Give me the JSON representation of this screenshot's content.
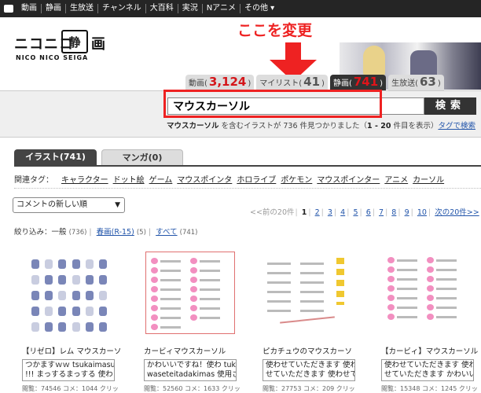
{
  "topbar": {
    "items": [
      "動画",
      "静画",
      "生放送",
      "チャンネル",
      "大百科",
      "実況",
      "Nアニメ",
      "その他 ▾"
    ]
  },
  "logo": {
    "line1a": "ニコニコ",
    "line1box": "静",
    "line1b": "画",
    "line2": "NICO NICO SEIGA"
  },
  "annotation": {
    "text": "ここを変更",
    "color": "#ee2222"
  },
  "service_tabs": [
    {
      "label": "動画(",
      "count": "3,124",
      "close": ")"
    },
    {
      "label": "マイリスト(",
      "count": "41",
      "close": ")"
    },
    {
      "label": "静画(",
      "count": "741",
      "close": ")"
    },
    {
      "label": "生放送(",
      "count": "63",
      "close": ")"
    }
  ],
  "search": {
    "query": "マウスカーソル",
    "button": "検索"
  },
  "result": {
    "keyword": "マウスカーソル",
    "text1": " を含むイラストが ",
    "count": "736",
    "text2": " 件見つかりました（",
    "range": "1 - 20",
    "text3": " 件目を表示）",
    "link": "タグで検索"
  },
  "content_tabs": [
    "イラスト(741)",
    "マンガ(0)"
  ],
  "related_tags": {
    "label": "関連タグ：",
    "tags": [
      "キャラクター",
      "ドット絵",
      "ゲーム",
      "マウスポインタ",
      "ホロライブ",
      "ポケモン",
      "マウスポインター",
      "アニメ",
      "カーソル"
    ]
  },
  "sort": {
    "selected": "コメントの新しい順",
    "chevron": "▼"
  },
  "pager": {
    "prev": "<<前の20件",
    "pages": [
      "1",
      "2",
      "3",
      "4",
      "5",
      "6",
      "7",
      "8",
      "9",
      "10"
    ],
    "next": "次の20件>>"
  },
  "filter": {
    "label": "絞り込み：",
    "general": "一般",
    "general_count": "(736)",
    "spring": "春画(R-15)",
    "spring_count": "(5)",
    "all": "すべて",
    "all_count": "(741)"
  },
  "cards": [
    {
      "title": "【リゼロ】レム マウスカーソ",
      "desc1": "つかますｗｗ tsukaimasu",
      "desc2": "!!! まっするまっする 使わ",
      "stats": "閲覧：74546 コメ：1044 クリッ"
    },
    {
      "title": "カービィマウスカーソル",
      "desc1": "かわいいですね！使わ tuka",
      "desc2": "waseteitadakimas 使用さ",
      "stats": "閲覧：52560 コメ：1633 クリッ"
    },
    {
      "title": "ピカチュウのマウスカーソ",
      "desc1": "使わせていただきます 使わ",
      "desc2": "せていただきます 使わせて",
      "stats": "閲覧：27753 コメ：209 クリッ"
    },
    {
      "title": "【カービィ】マウスカーソル",
      "desc1": "使わせていただきます 使わ",
      "desc2": "せていただきます かわいい",
      "stats": "閲覧：15348 コメ：1245 クリッ"
    }
  ]
}
